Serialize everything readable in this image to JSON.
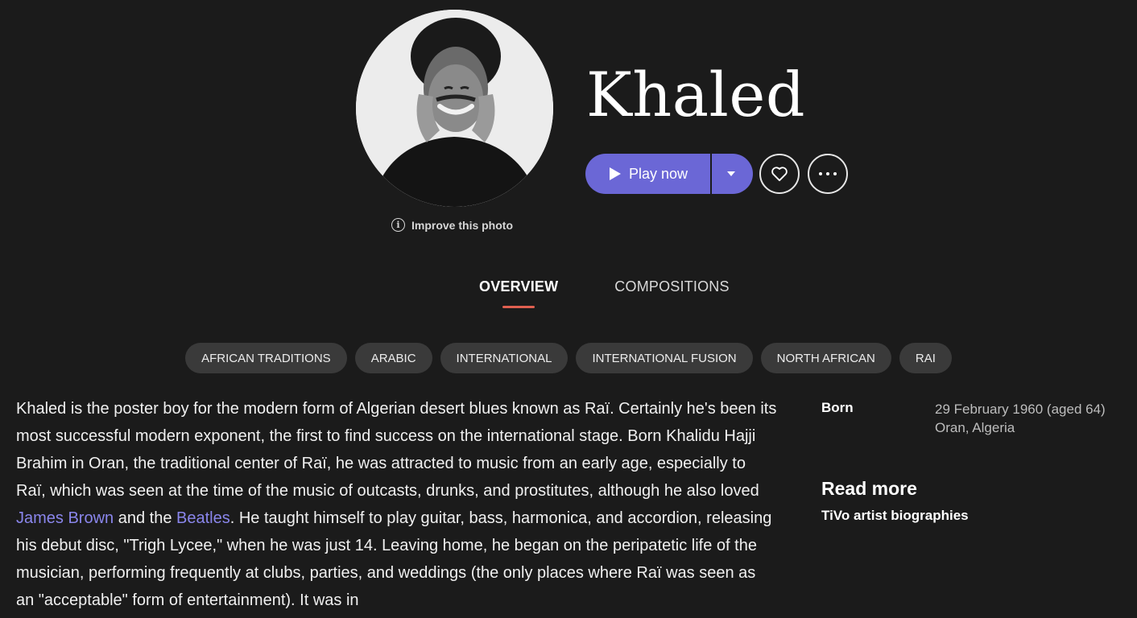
{
  "artist": {
    "name": "Khaled",
    "photo_alt": "Khaled"
  },
  "photo": {
    "improve_label": "Improve this photo",
    "info_glyph": "i"
  },
  "actions": {
    "play_label": "Play now",
    "play_icon": "play-icon",
    "dropdown_icon": "caret-down-icon",
    "favorite_icon": "heart-icon",
    "more_icon": "more-dots-icon"
  },
  "tabs": [
    {
      "label": "OVERVIEW",
      "active": true
    },
    {
      "label": "COMPOSITIONS",
      "active": false
    }
  ],
  "genres": [
    "AFRICAN TRADITIONS",
    "ARABIC",
    "INTERNATIONAL",
    "INTERNATIONAL FUSION",
    "NORTH AFRICAN",
    "RAI"
  ],
  "bio": {
    "part1": "Khaled is the poster boy for the modern form of Algerian desert blues known as Raï. Certainly he's been its most successful modern exponent, the first to find success on the international stage. Born Khalidu Hajji Brahim in Oran, the traditional center of Raï, he was attracted to music from an early age, especially to Raï, which was seen at the time of the music of outcasts, drunks, and prostitutes, although he also loved ",
    "link1": "James Brown",
    "part2": " and the ",
    "link2": "Beatles",
    "part3": ". He taught himself to play guitar, bass, harmonica, and accordion, releasing his debut disc, \"Trigh Lycee,\" when he was just 14. Leaving home, he began on the peripatetic life of the musician, performing frequently at clubs, parties, and weddings (the only places where Raï was seen as an \"acceptable\" form of entertainment). It was in"
  },
  "born": {
    "label": "Born",
    "date": "29 February 1960 (aged 64)",
    "place": "Oran, Algeria"
  },
  "read_more": {
    "heading": "Read more",
    "link": "TiVo artist biographies"
  },
  "colors": {
    "background": "#1b1b1b",
    "accent": "#6b67d6",
    "tab_indicator": "#e06050",
    "link": "#8a86ec",
    "chip": "#3a3a3a"
  }
}
